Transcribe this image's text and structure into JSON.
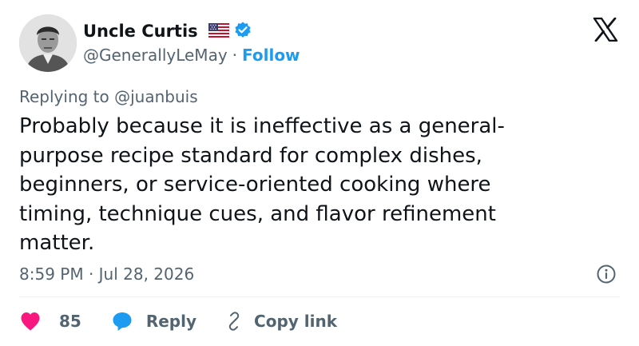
{
  "author": {
    "display_name": "Uncle Curtis",
    "handle": "@GenerallyLeMay",
    "separator": "·",
    "follow_label": "Follow",
    "flag_icon": "us-flag-icon",
    "verified_icon": "verified-badge-icon"
  },
  "reply_context": {
    "prefix": "Replying to",
    "mention": "@juanbuis"
  },
  "tweet": {
    "lines": [
      "Probably because it is ineffective as a general-",
      "purpose recipe standard for complex dishes,",
      "beginners, or service-oriented cooking where",
      "timing, technique cues, and flavor refinement",
      "matter."
    ],
    "timestamp": "8:59 PM · Jul 28, 2026"
  },
  "actions": {
    "like_count": "85",
    "reply_label": "Reply",
    "copy_link_label": "Copy link"
  },
  "colors": {
    "accent": "#1d9bf0",
    "like": "#f91880",
    "muted_text": "#536471",
    "text": "#0f1419",
    "divider": "#eff3f4"
  }
}
